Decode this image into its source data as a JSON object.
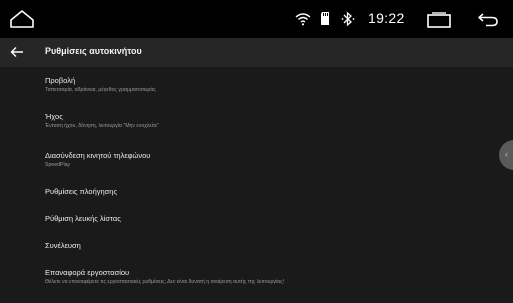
{
  "status_bar": {
    "time": "19:22",
    "icons": [
      "home-icon",
      "wifi-icon",
      "sd-card-icon",
      "bluetooth-icon",
      "recents-icon",
      "back-icon"
    ]
  },
  "toolbar": {
    "back_icon": "arrow-left-icon",
    "title": "Ρυθμίσεις αυτοκινήτου"
  },
  "settings": {
    "items": [
      {
        "title": "Προβολή",
        "subtitle": "Ταπετσαρία, αδράνεια, μέγεθος γραμματοσειράς"
      },
      {
        "title": "Ήχος",
        "subtitle": "Ένταση ήχου, δόνηση, λειτουργία \"Μην ενοχλείτε\""
      },
      {
        "title": "Διασύνδεση κινητού τηλεφώνου",
        "subtitle": "SpeedPlay"
      },
      {
        "title": "Ρυθμίσεις πλοήγησης"
      },
      {
        "title": "Ρύθμιση λευκής λίστας"
      },
      {
        "title": "Συνέλευση"
      },
      {
        "title": "Επαναφορά εργοστασίου",
        "subtitle": "Θέλετε να επαναφέρετε τις εργοστασιακές ρυθμίσεις; Δεν είναι δυνατή η αναίρεση αυτής της λειτουργίας!"
      }
    ]
  },
  "colors": {
    "status_bar": "#000000",
    "toolbar": "#262626",
    "background": "#1a1a1a",
    "text": "#ececec",
    "subtext": "#9a9a9a"
  }
}
